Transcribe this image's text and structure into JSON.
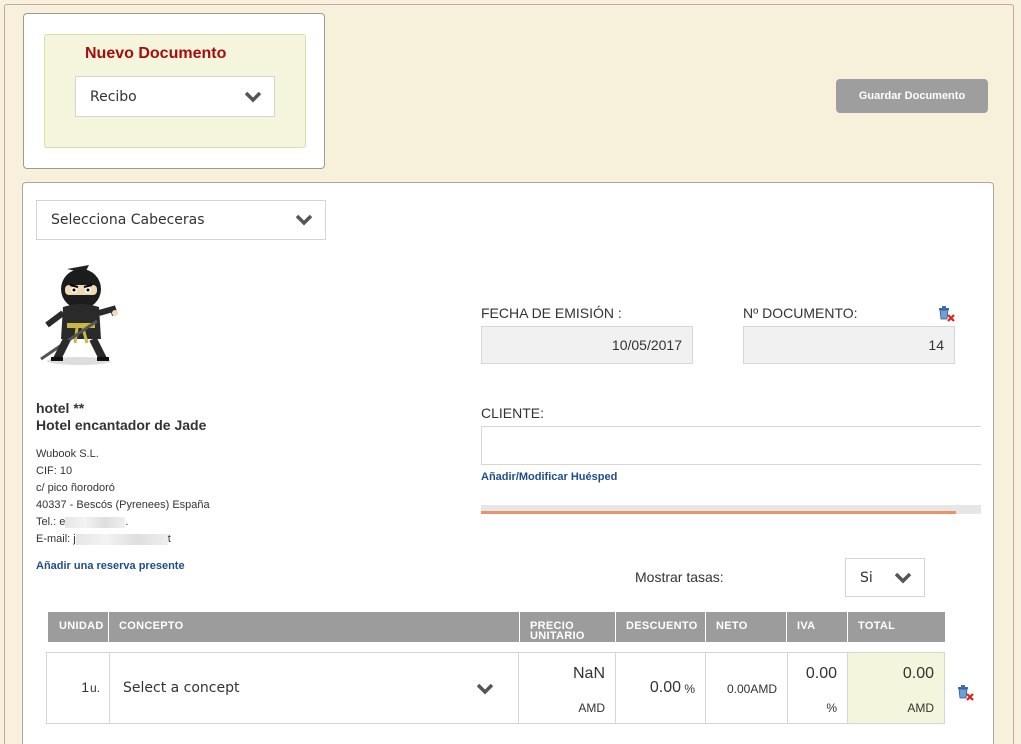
{
  "new_doc": {
    "title": "Nuevo Documento",
    "type_value": "Recibo"
  },
  "toolbar": {
    "save_label": "Guardar Documento"
  },
  "headers_select": {
    "value": "Selecciona Cabeceras"
  },
  "hotel": {
    "name_line1": "hotel **",
    "name_line2": "Hotel encantador de Jade",
    "company": "Wubook S.L.",
    "cif": "CIF: 10",
    "address": "c/ pico ñorodoró",
    "city": "40337 - Bescós (Pyrenees) España",
    "tel_label": "Tel.: ",
    "tel_prefix": "e",
    "tel_suffix": ".",
    "email_label": "E-mail: ",
    "email_prefix": "j",
    "email_suffix": "t"
  },
  "links": {
    "add_reservation": "Añadir una reserva presente",
    "add_guest": "Añadir/Modificar Huésped"
  },
  "issue_date": {
    "label": "FECHA DE EMISIÓN :",
    "value": "10/05/2017"
  },
  "doc_number": {
    "label": "Nº DOCUMENTO:",
    "value": "14"
  },
  "client": {
    "label": "CLIENTE:",
    "value": ""
  },
  "progress": {
    "fraction": 0.95
  },
  "taxes": {
    "label": "Mostrar tasas:",
    "value": "Si"
  },
  "table": {
    "headers": [
      "UNIDAD",
      "CONCEPTO",
      "PRECIO UNITARIO",
      "DESCUENTO",
      "NETO",
      "IVA",
      "TOTAL"
    ],
    "row": {
      "units": "1",
      "units_suffix": "u.",
      "concept": "Select a concept",
      "unit_price": "NaN",
      "unit_price_currency": "AMD",
      "discount": "0.00",
      "discount_unit": "%",
      "net": "0.00AMD",
      "vat": "0.00",
      "vat_unit": "%",
      "total": "0.00",
      "total_currency": "AMD"
    }
  },
  "colors": {
    "brand_red": "#a60c0c",
    "link_blue": "#1f4d8a",
    "header_gray": "#9c9c9c",
    "total_bg": "#f3f6dc",
    "progress": "#e8936a"
  },
  "icons": [
    "chevron-down-icon",
    "trash-icon",
    "search-icon",
    "ninja-logo"
  ]
}
